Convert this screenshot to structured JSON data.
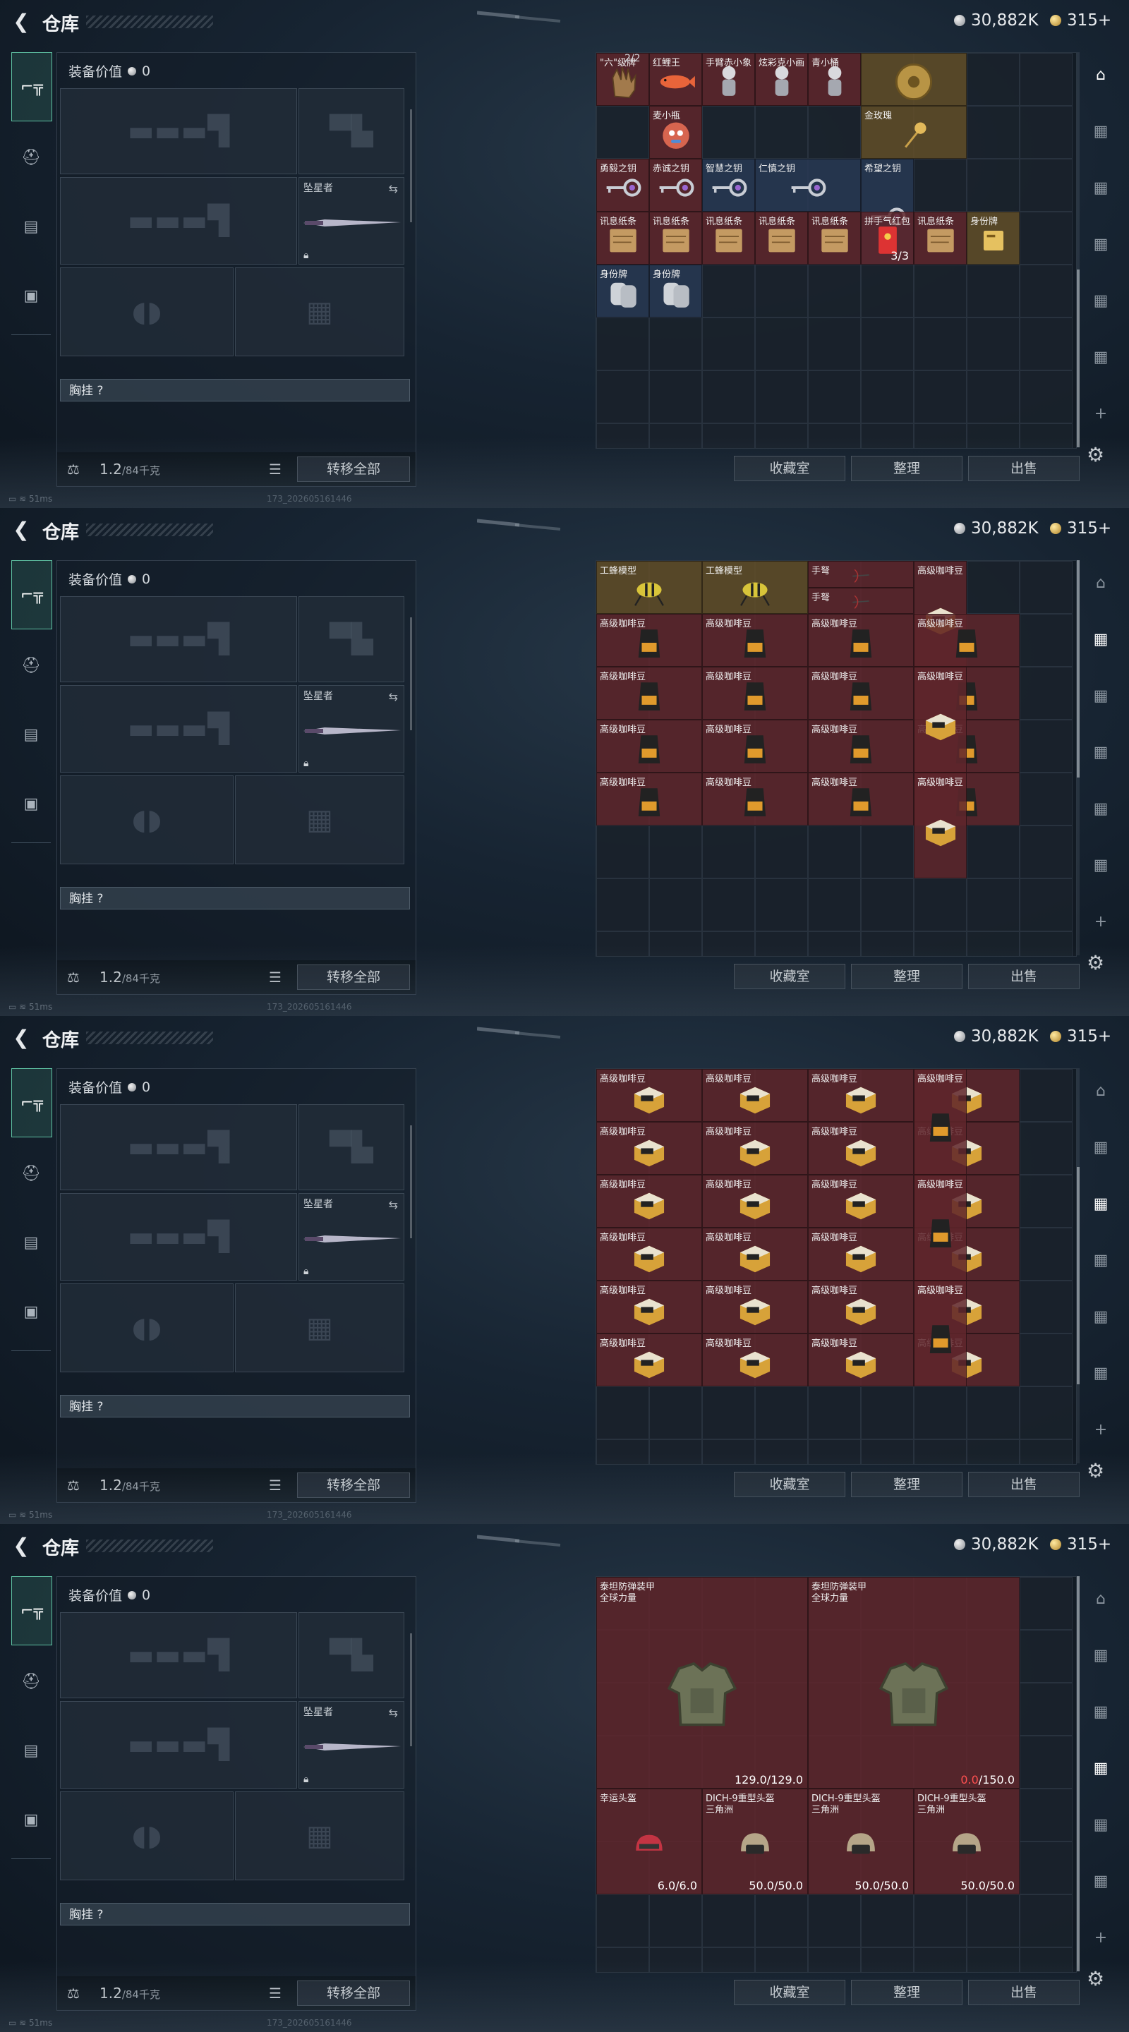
{
  "window": {
    "title": "仓库"
  },
  "currency": {
    "silver": "30,882K",
    "gold": "315+"
  },
  "loadout": {
    "value_label": "装备价值",
    "value": "0",
    "melee_name": "坠星者",
    "rig_label": "胸挂 ?",
    "weight": "1.2",
    "weight_max": "/84千克",
    "transfer_all": "转移全部"
  },
  "actions": {
    "collection": "收藏室",
    "sort": "整理",
    "sell": "出售"
  },
  "status": {
    "ping": "51ms",
    "build": "173_202605161446"
  },
  "panels": [
    {
      "page_counter": "2/2",
      "scroll": {
        "top": 0.55,
        "height": 0.45
      },
      "active_nav": 0,
      "cells": [
        {
          "label": "\"六\"级牌",
          "color": "red",
          "icon": "glove-icon"
        },
        {
          "label": "红鲤王",
          "color": "red",
          "icon": "koi-fish-icon"
        },
        {
          "label": "手臂赤小象",
          "color": "red",
          "icon": "figurine-icon"
        },
        {
          "label": "炫彩克小画",
          "color": "red",
          "icon": "figurine-icon"
        },
        {
          "label": "青小桶",
          "color": "red",
          "icon": "figurine-icon"
        },
        {
          "label": "",
          "color": "gold",
          "icon": "dial-icon"
        },
        {
          "label": "麦小瓶",
          "color": "red",
          "icon": "mascot-icon"
        },
        {
          "label": "金玫瑰",
          "color": "gold",
          "icon": "golden-rose-icon"
        },
        {
          "label": "勇毅之钥",
          "color": "red",
          "icon": "key-icon"
        },
        {
          "label": "赤诚之钥",
          "color": "red",
          "icon": "key-icon"
        },
        {
          "label": "智慧之钥",
          "color": "blue",
          "icon": "key-icon"
        },
        {
          "label": "仁慎之钥",
          "color": "blue",
          "icon": "key-icon"
        },
        {
          "label": "希望之钥",
          "color": "blue",
          "icon": "key-icon"
        },
        {
          "label": "讯息纸条",
          "color": "red",
          "icon": "note-icon"
        },
        {
          "label": "讯息纸条",
          "color": "red",
          "icon": "note-icon"
        },
        {
          "label": "讯息纸条",
          "color": "red",
          "icon": "note-icon"
        },
        {
          "label": "讯息纸条",
          "color": "red",
          "icon": "note-icon"
        },
        {
          "label": "讯息纸条",
          "color": "red",
          "icon": "note-icon"
        },
        {
          "label": "拼手气红包",
          "color": "red",
          "icon": "red-envelope-icon",
          "value": "3/3"
        },
        {
          "label": "讯息纸条",
          "color": "red",
          "icon": "note-icon"
        },
        {
          "label": "身份牌",
          "color": "gold",
          "icon": "id-card-icon"
        },
        {
          "label": "身份牌",
          "color": "blue",
          "icon": "dog-tag-icon"
        },
        {
          "label": "身份牌",
          "color": "blue",
          "icon": "dog-tag-icon"
        }
      ]
    },
    {
      "scroll": {
        "top": 0.0,
        "height": 0.55
      },
      "active_nav": 1,
      "cells": [
        {
          "label": "工蜂模型",
          "color": "gold",
          "icon": "wasp-model-icon"
        },
        {
          "label": "工蜂模型",
          "color": "gold",
          "icon": "wasp-model-icon"
        },
        {
          "label": "手弩",
          "color": "red",
          "icon": "crossbow-icon"
        },
        {
          "label": "手弩",
          "color": "red",
          "icon": "crossbow-icon"
        },
        {
          "label": "高级咖啡豆",
          "color": "red",
          "icon": "coffee-bag-icon"
        },
        {
          "label": "高级咖啡豆",
          "color": "red",
          "icon": "coffee-box-icon"
        }
      ]
    },
    {
      "scroll": {
        "top": 0.25,
        "height": 0.55
      },
      "active_nav": 2,
      "cells": [
        {
          "label": "高级咖啡豆",
          "color": "red",
          "icon": "coffee-box-icon"
        },
        {
          "label": "高级咖啡豆",
          "color": "red",
          "icon": "coffee-bag-icon"
        }
      ]
    },
    {
      "scroll": {
        "top": 0.0,
        "height": 1.0
      },
      "active_nav": 3,
      "cells": [
        {
          "label": "泰坦防弹装甲",
          "label2": "全球力量",
          "color": "red",
          "icon": "body-armor-icon",
          "value": "129.0/129.0"
        },
        {
          "label": "泰坦防弹装甲",
          "label2": "全球力量",
          "color": "red",
          "icon": "body-armor-icon",
          "value_current": "0.0",
          "value": "/150.0"
        },
        {
          "label": "幸运头盔",
          "color": "red",
          "icon": "red-helmet-icon",
          "value": "6.0/6.0"
        },
        {
          "label": "DICH-9重型头盔",
          "label2": "三角洲",
          "color": "red",
          "icon": "heavy-helmet-icon",
          "value": "50.0/50.0"
        },
        {
          "label": "DICH-9重型头盔",
          "label2": "三角洲",
          "color": "red",
          "icon": "heavy-helmet-icon",
          "value": "50.0/50.0"
        },
        {
          "label": "DICH-9重型头盔",
          "label2": "三角洲",
          "color": "red",
          "icon": "heavy-helmet-icon",
          "value": "50.0/50.0"
        }
      ]
    }
  ]
}
